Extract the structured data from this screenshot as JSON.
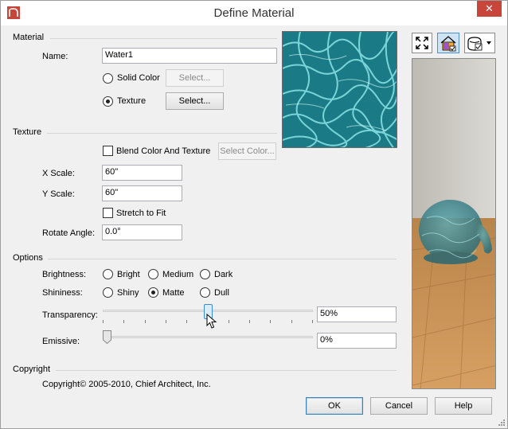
{
  "window": {
    "title": "Define Material",
    "close_label": "✕"
  },
  "material": {
    "group_title": "Material",
    "name_label": "Name:",
    "name_value": "Water1",
    "solid_color_label": "Solid Color",
    "solid_color_button": "Select...",
    "texture_label": "Texture",
    "texture_button": "Select...",
    "selected": "Texture"
  },
  "texture": {
    "group_title": "Texture",
    "blend_label": "Blend Color And Texture",
    "blend_checked": false,
    "select_color_button": "Select Color...",
    "x_scale_label": "X Scale:",
    "x_scale_value": "60\"",
    "y_scale_label": "Y Scale:",
    "y_scale_value": "60\"",
    "stretch_label": "Stretch to Fit",
    "stretch_checked": false,
    "rotate_label": "Rotate Angle:",
    "rotate_value": "0.0°"
  },
  "options": {
    "group_title": "Options",
    "brightness_label": "Brightness:",
    "brightness_options": [
      "Bright",
      "Medium",
      "Dark"
    ],
    "brightness_selected": null,
    "shininess_label": "Shininess:",
    "shininess_options": [
      "Shiny",
      "Matte",
      "Dull"
    ],
    "shininess_selected": "Matte",
    "transparency_label": "Transparency:",
    "transparency_value": "50%",
    "transparency_level": 0.5,
    "emissive_label": "Emissive:",
    "emissive_value": "0%",
    "emissive_level": 0
  },
  "copyright": {
    "group_title": "Copyright",
    "text": "Copyright© 2005-2010, Chief Architect, Inc."
  },
  "toolbar": {
    "icons": [
      "fullscreen-icon",
      "material-house-icon",
      "render-options-icon"
    ]
  },
  "footer": {
    "ok_label": "OK",
    "cancel_label": "Cancel",
    "help_label": "Help"
  },
  "colors": {
    "accent": "#c7453b",
    "water": "#1f8c93",
    "floor": "#c98f52",
    "wall": "#cfcdc8"
  }
}
